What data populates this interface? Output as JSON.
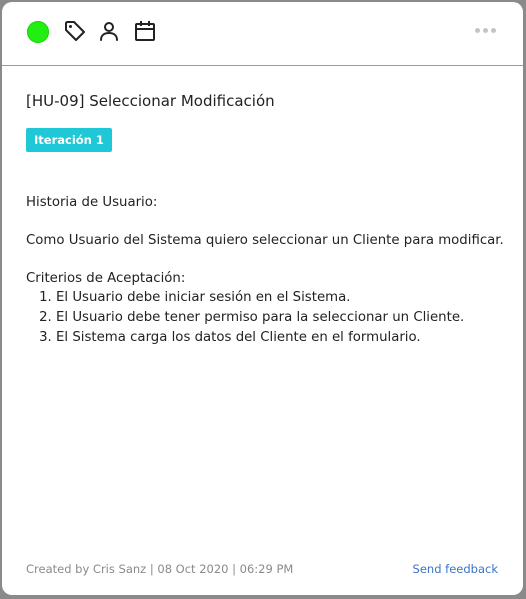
{
  "toolbar": {
    "status_color": "#22ee11",
    "icons": [
      "tag-icon",
      "user-icon",
      "calendar-icon",
      "more-icon"
    ]
  },
  "card": {
    "title": "[HU-09] Seleccionar Modificación",
    "badge": "Iteración 1",
    "badge_color": "#1fc8d6"
  },
  "description": {
    "heading": "Historia de Usuario:",
    "story": "Como Usuario del Sistema quiero seleccionar un Cliente para modificar.",
    "criteria_heading": "Criterios de Aceptación:",
    "criteria": [
      "El Usuario debe iniciar sesión en el Sistema.",
      "El Usuario debe tener permiso para la seleccionar un Cliente.",
      "El Sistema carga los datos del Cliente en el formulario."
    ]
  },
  "footer": {
    "created_by": "Created by Cris Sanz | 08 Oct 2020 | 06:29 PM",
    "feedback": "Send feedback"
  }
}
